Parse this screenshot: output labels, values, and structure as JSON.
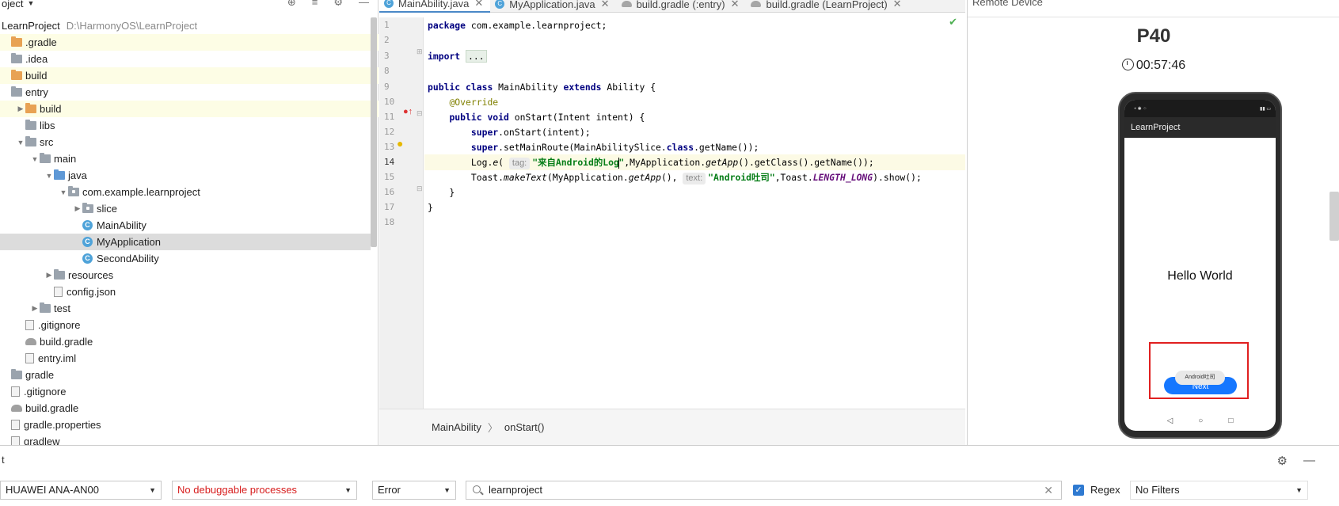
{
  "project": {
    "title": "oject",
    "root": "LearnProject",
    "root_path": "D:\\HarmonyOS\\LearnProject",
    "items": [
      {
        "label": ".gradle",
        "indent": 0,
        "icon": "folder-orange",
        "hl": true
      },
      {
        "label": ".idea",
        "indent": 0,
        "icon": "folder-gray"
      },
      {
        "label": "build",
        "indent": 0,
        "icon": "folder-orange",
        "hl": true
      },
      {
        "label": "entry",
        "indent": 0,
        "icon": "folder-gray"
      },
      {
        "label": "build",
        "indent": 1,
        "icon": "folder-orange",
        "hl": true,
        "arrow": "right"
      },
      {
        "label": "libs",
        "indent": 1,
        "icon": "folder-gray"
      },
      {
        "label": "src",
        "indent": 1,
        "icon": "folder-gray",
        "arrow": "down"
      },
      {
        "label": "main",
        "indent": 2,
        "icon": "folder-gray",
        "arrow": "down"
      },
      {
        "label": "java",
        "indent": 3,
        "icon": "folder-blue",
        "arrow": "down"
      },
      {
        "label": "com.example.learnproject",
        "indent": 4,
        "icon": "package",
        "arrow": "down"
      },
      {
        "label": "slice",
        "indent": 5,
        "icon": "package",
        "arrow": "right"
      },
      {
        "label": "MainAbility",
        "indent": 5,
        "icon": "class"
      },
      {
        "label": "MyApplication",
        "indent": 5,
        "icon": "class",
        "sel": true
      },
      {
        "label": "SecondAbility",
        "indent": 5,
        "icon": "class"
      },
      {
        "label": "resources",
        "indent": 3,
        "icon": "folder-gray",
        "arrow": "right"
      },
      {
        "label": "config.json",
        "indent": 3,
        "icon": "file"
      },
      {
        "label": "test",
        "indent": 2,
        "icon": "folder-gray",
        "arrow": "right"
      },
      {
        "label": ".gitignore",
        "indent": 1,
        "icon": "file"
      },
      {
        "label": "build.gradle",
        "indent": 1,
        "icon": "gradle"
      },
      {
        "label": "entry.iml",
        "indent": 1,
        "icon": "file"
      },
      {
        "label": "gradle",
        "indent": 0,
        "icon": "folder-gray"
      },
      {
        "label": ".gitignore",
        "indent": 0,
        "icon": "file"
      },
      {
        "label": "build.gradle",
        "indent": 0,
        "icon": "gradle"
      },
      {
        "label": "gradle.properties",
        "indent": 0,
        "icon": "file"
      },
      {
        "label": "gradlew",
        "indent": 0,
        "icon": "file"
      }
    ]
  },
  "tabs": [
    {
      "label": "MainAbility.java",
      "icon": "java",
      "active": true
    },
    {
      "label": "MyApplication.java",
      "icon": "java"
    },
    {
      "label": "build.gradle (:entry)",
      "icon": "gradle"
    },
    {
      "label": "build.gradle (LearnProject)",
      "icon": "gradle"
    }
  ],
  "code": {
    "line_numbers": [
      "1",
      "2",
      "3",
      "8",
      "9",
      "10",
      "11",
      "12",
      "13",
      "14",
      "15",
      "16",
      "17",
      "18"
    ],
    "l1_kw": "package",
    "l1_rest": " com.example.learnproject;",
    "l3_kw": "import",
    "l3_fold": "...",
    "l9_kw1": "public",
    "l9_kw2": "class",
    "l9_mid": " MainAbility ",
    "l9_kw3": "extends",
    "l9_rest": " Ability {",
    "l10_ann": "@Override",
    "l11_kw1": "public",
    "l11_kw2": "void",
    "l11_rest": " onStart(Intent intent) {",
    "l12_kw": "super",
    "l12_rest": ".onStart(intent);",
    "l13_kw": "super",
    "l13_a": ".setMainRoute(MainAbilitySlice.",
    "l13_kw2": "class",
    "l13_b": ".getName());",
    "l14_a": "Log.",
    "l14_m": "e",
    "l14_b": "( ",
    "l14_hint": "tag:",
    "l14_str1": "\"来自Android的Log",
    "l14_str2": "\"",
    "l14_c": ",MyApplication.",
    "l14_m2": "getApp",
    "l14_d": "().getClass().getName());",
    "l15_a": "Toast.",
    "l15_m": "makeText",
    "l15_b": "(MyApplication.",
    "l15_m2": "getApp",
    "l15_c": "(), ",
    "l15_hint": "text:",
    "l15_str": "\"Android吐司\"",
    "l15_d": ",Toast.",
    "l15_const": "LENGTH_LONG",
    "l15_e": ").show();",
    "l16": "    }",
    "l17": "}"
  },
  "breadcrumb": {
    "class_name": "MainAbility",
    "method": "onStart()"
  },
  "device": {
    "header": "Remote Device",
    "name": "P40",
    "timer": "00:57:46",
    "app_title": "LearnProject",
    "hello": "Hello World",
    "toast": "Android吐司",
    "button": "Next"
  },
  "logcat": {
    "title": "t",
    "device": "HUAWEI ANA-AN00",
    "process": "No debuggable processes",
    "level": "Error",
    "search": "learnproject",
    "regex_label": "Regex",
    "regex_checked": true,
    "filter": "No Filters"
  }
}
